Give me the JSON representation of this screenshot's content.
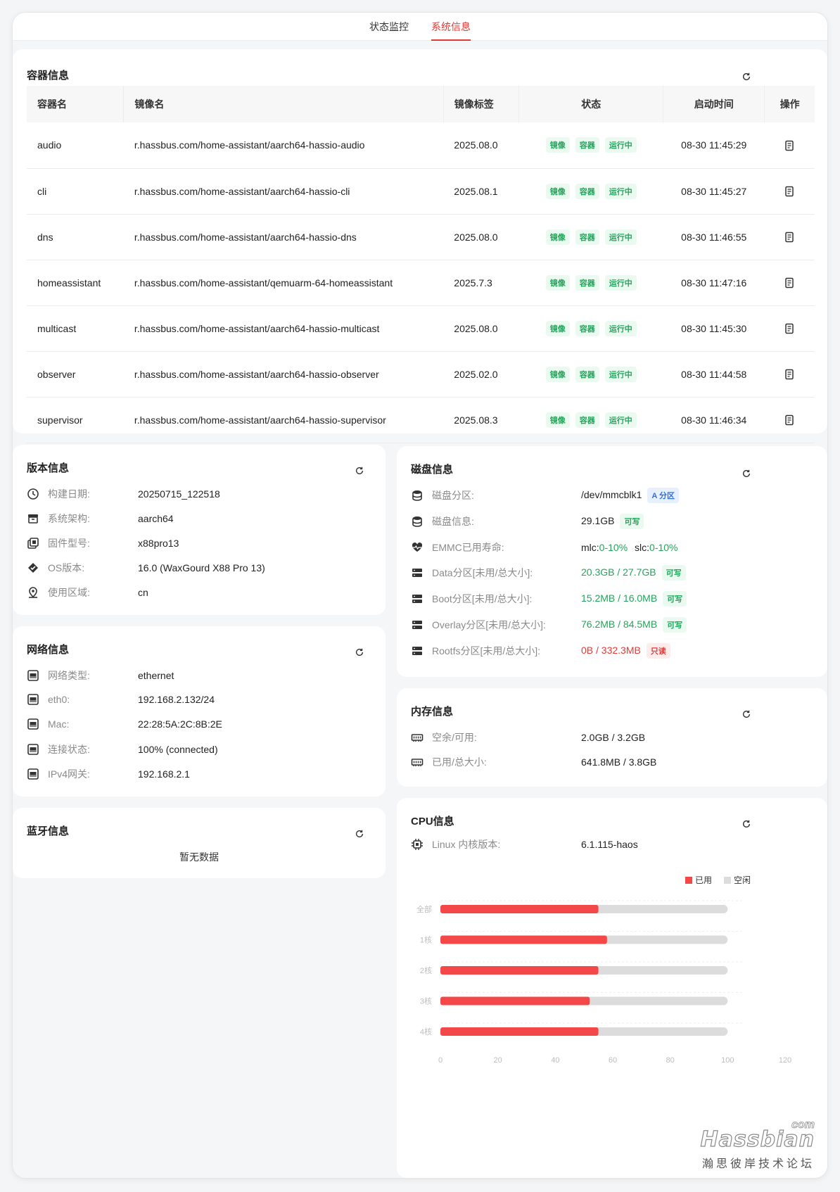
{
  "tabs": [
    {
      "label": "状态监控",
      "active": false
    },
    {
      "label": "系统信息",
      "active": true
    }
  ],
  "containers": {
    "title": "容器信息",
    "headers": [
      "容器名",
      "镜像名",
      "镜像标签",
      "状态",
      "启动时间",
      "操作"
    ],
    "status_tags": [
      "镜像",
      "容器",
      "运行中"
    ],
    "rows": [
      {
        "name": "audio",
        "image": "r.hassbus.com/home-assistant/aarch64-hassio-audio",
        "tag": "2025.08.0",
        "time": "08-30 11:45:29"
      },
      {
        "name": "cli",
        "image": "r.hassbus.com/home-assistant/aarch64-hassio-cli",
        "tag": "2025.08.1",
        "time": "08-30 11:45:27"
      },
      {
        "name": "dns",
        "image": "r.hassbus.com/home-assistant/aarch64-hassio-dns",
        "tag": "2025.08.0",
        "time": "08-30 11:46:55"
      },
      {
        "name": "homeassistant",
        "image": "r.hassbus.com/home-assistant/qemuarm-64-homeassistant",
        "tag": "2025.7.3",
        "time": "08-30 11:47:16"
      },
      {
        "name": "multicast",
        "image": "r.hassbus.com/home-assistant/aarch64-hassio-multicast",
        "tag": "2025.08.0",
        "time": "08-30 11:45:30"
      },
      {
        "name": "observer",
        "image": "r.hassbus.com/home-assistant/aarch64-hassio-observer",
        "tag": "2025.02.0",
        "time": "08-30 11:44:58"
      },
      {
        "name": "supervisor",
        "image": "r.hassbus.com/home-assistant/aarch64-hassio-supervisor",
        "tag": "2025.08.3",
        "time": "08-30 11:46:34"
      }
    ]
  },
  "version": {
    "title": "版本信息",
    "rows": [
      {
        "icon": "clock-icon",
        "label": "构建日期:",
        "value": "20250715_122518"
      },
      {
        "icon": "box-icon",
        "label": "系统架构:",
        "value": "aarch64"
      },
      {
        "icon": "layers-icon",
        "label": "固件型号:",
        "value": "x88pro13"
      },
      {
        "icon": "os-icon",
        "label": "OS版本:",
        "value": "16.0 (WaxGourd X88 Pro 13)"
      },
      {
        "icon": "location-icon",
        "label": "使用区域:",
        "value": "cn"
      }
    ]
  },
  "network": {
    "title": "网络信息",
    "rows": [
      {
        "label": "网络类型:",
        "value": "ethernet"
      },
      {
        "label": "eth0:",
        "value": "192.168.2.132/24"
      },
      {
        "label": "Mac:",
        "value": "22:28:5A:2C:8B:2E"
      },
      {
        "label": "连接状态:",
        "value": "100% (connected)"
      },
      {
        "label": "IPv4网关:",
        "value": "192.168.2.1"
      }
    ]
  },
  "bluetooth": {
    "title": "蓝牙信息",
    "empty": "暂无数据"
  },
  "disk": {
    "title": "磁盘信息",
    "rows": [
      {
        "label": "磁盘分区:",
        "value": "/dev/mmcblk1",
        "badge": "A 分区",
        "badge_type": "blue",
        "value_color": "normal"
      },
      {
        "label": "磁盘信息:",
        "value": "29.1GB",
        "badge": "可写",
        "badge_type": "green",
        "value_color": "normal"
      },
      {
        "label": "EMMC已用寿命:",
        "value": "",
        "value_color": "normal"
      },
      {
        "label": "Data分区[未用/总大小]:",
        "value": "20.3GB / 27.7GB",
        "badge": "可写",
        "badge_type": "green",
        "value_color": "green"
      },
      {
        "label": "Boot分区[未用/总大小]:",
        "value": "15.2MB / 16.0MB",
        "badge": "可写",
        "badge_type": "green",
        "value_color": "green"
      },
      {
        "label": "Overlay分区[未用/总大小]:",
        "value": "76.2MB / 84.5MB",
        "badge": "可写",
        "badge_type": "green",
        "value_color": "green"
      },
      {
        "label": "Rootfs分区[未用/总大小]:",
        "value": "0B / 332.3MB",
        "badge": "只读",
        "badge_type": "red",
        "value_color": "red"
      }
    ],
    "emmc": {
      "mlc_label": "mlc:",
      "mlc_value": "0-10%",
      "slc_label": "slc:",
      "slc_value": "0-10%"
    }
  },
  "memory": {
    "title": "内存信息",
    "rows": [
      {
        "label": "空余/可用:",
        "value": "2.0GB / 3.2GB"
      },
      {
        "label": "已用/总大小:",
        "value": "641.8MB / 3.8GB"
      }
    ]
  },
  "cpu": {
    "title": "CPU信息",
    "kernel_label": "Linux 内核版本:",
    "kernel_value": "6.1.115-haos"
  },
  "chart_data": {
    "type": "bar",
    "orientation": "horizontal",
    "stacked": true,
    "categories": [
      "全部",
      "1核",
      "2核",
      "3核",
      "4核"
    ],
    "series": [
      {
        "name": "已用",
        "color": "#f44848",
        "values": [
          55,
          58,
          55,
          52,
          55
        ]
      },
      {
        "name": "空闲",
        "color": "#dcdcdc",
        "values": [
          45,
          42,
          45,
          48,
          45
        ]
      }
    ],
    "xlim": [
      0,
      120
    ],
    "xticks": [
      0,
      20,
      40,
      60,
      80,
      100,
      120
    ],
    "legend_position": "top-right",
    "grid": true
  },
  "watermark": {
    "brand": "Hassbian",
    "suffix": "com",
    "subtitle": "瀚思彼岸技术论坛"
  }
}
